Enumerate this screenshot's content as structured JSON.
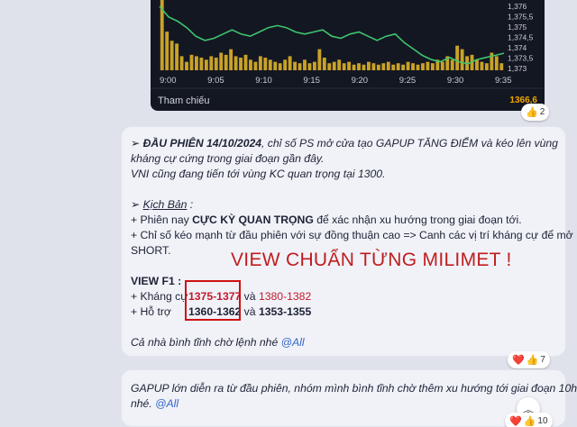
{
  "chart": {
    "x_ticks": [
      "9:00",
      "9:05",
      "9:10",
      "9:15",
      "9:20",
      "9:25",
      "9:30",
      "9:35"
    ],
    "y_ticks": [
      "1,376",
      "1,375,5",
      "1,375",
      "1,374,5",
      "1,374",
      "1,373,5",
      "1,373"
    ],
    "reference_label": "Tham chiếu",
    "reference_value": "1366,6",
    "bar_color": "#c9a227",
    "line_color": "#3ec46d",
    "volume_bars": [
      1.0,
      0.55,
      0.42,
      0.38,
      0.2,
      0.12,
      0.22,
      0.2,
      0.18,
      0.15,
      0.2,
      0.18,
      0.25,
      0.22,
      0.3,
      0.2,
      0.18,
      0.22,
      0.15,
      0.12,
      0.2,
      0.18,
      0.15,
      0.12,
      0.1,
      0.15,
      0.2,
      0.12,
      0.1,
      0.15,
      0.1,
      0.12,
      0.3,
      0.18,
      0.1,
      0.12,
      0.15,
      0.1,
      0.12,
      0.08,
      0.1,
      0.08,
      0.12,
      0.1,
      0.08,
      0.1,
      0.12,
      0.08,
      0.1,
      0.08,
      0.12,
      0.1,
      0.08,
      0.1,
      0.12,
      0.1,
      0.15,
      0.12,
      0.2,
      0.15,
      0.35,
      0.3,
      0.2,
      0.22,
      0.15,
      0.12,
      0.1,
      0.25,
      0.2,
      0.1
    ],
    "price_line": [
      1375.9,
      1375.4,
      1375.2,
      1374.9,
      1374.5,
      1374.3,
      1374.4,
      1374.6,
      1374.8,
      1374.6,
      1374.5,
      1374.7,
      1374.9,
      1375.0,
      1374.9,
      1374.7,
      1374.6,
      1374.7,
      1374.8,
      1374.5,
      1374.4,
      1374.6,
      1374.7,
      1374.5,
      1374.3,
      1374.5,
      1374.6,
      1374.2,
      1373.9,
      1373.6,
      1373.4,
      1373.3,
      1373.5,
      1373.3,
      1373.2,
      1373.4,
      1373.5,
      1373.6,
      1373.7
    ]
  },
  "reactions1": {
    "emoji": "👍",
    "count": "2"
  },
  "message1": {
    "line1_arrow": "➢ ",
    "line1_bold": "ĐẦU PHIÊN 14/10/2024",
    "line1_rest": ", chỉ số PS mở cửa tạo GAPUP TĂNG ĐIỂM và kéo lên vùng",
    "line2": "kháng cự cứng trong giai đoạn gần đây.",
    "line3": "VNI cũng đang tiến tới vùng KC quan trọng tại 1300.",
    "scenario_arrow": "➢ ",
    "scenario_label": "Kịch Bản",
    "scenario_colon": " :",
    "bullet1_a": "+ Phiên nay ",
    "bullet1_b": "CỰC KỲ QUAN TRỌNG",
    "bullet1_c": " để xác nhận xu hướng trong giai đoạn tới.",
    "bullet2": "+ Chỉ số kéo mạnh từ đầu phiên với sự đồng thuận cao => Canh các vị trí kháng cự để mở",
    "bullet3": "SHORT.",
    "view_title": "VIEW F1 :",
    "res_label": "+ Kháng cự",
    "res_1": "1375-1377",
    "res_and": " và ",
    "res_2": "1380-1382",
    "sup_label": "+ Hỗ trợ",
    "sup_1": "1360-1362",
    "sup_and": " và ",
    "sup_2": "1353-1355",
    "closing": "Cả nhà bình tĩnh chờ lệnh nhé ",
    "mention": "@All",
    "overlay": "VIEW CHUẨN TỪNG MILIMET !"
  },
  "reactions2": {
    "emoji1": "❤️",
    "emoji2": "👍",
    "count": "7"
  },
  "message2": {
    "line1": "GAPUP lớn diễn ra từ đầu phiên, nhóm mình bình tĩnh chờ thêm xu hướng tới giai đoạn 10h",
    "line2": "nhé. ",
    "mention": "@All"
  },
  "reactions3": {
    "emoji1": "❤️",
    "emoji2": "👍",
    "count": "10"
  },
  "scroll_icon": "double-chevron-up"
}
